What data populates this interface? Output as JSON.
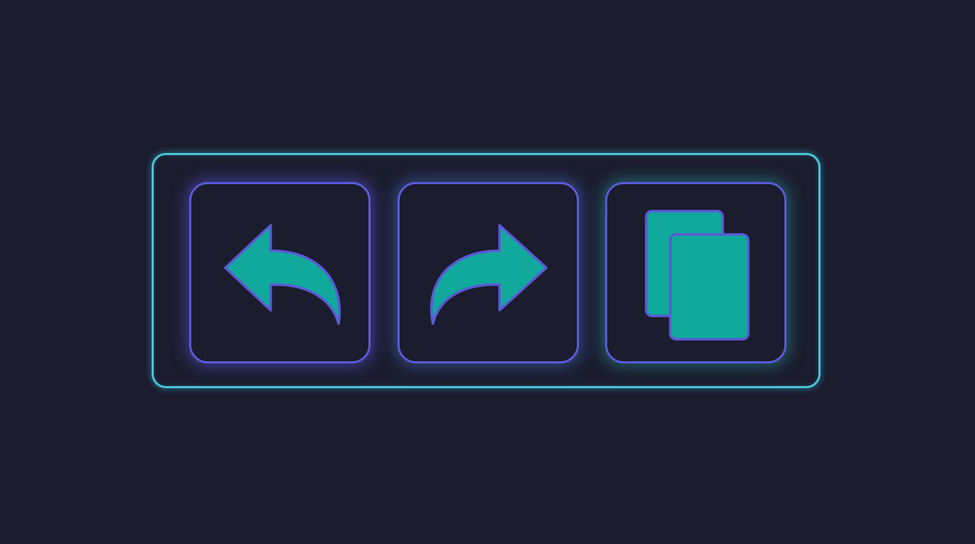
{
  "toolbar": {
    "buttons": [
      {
        "id": "undo",
        "icon": "undo-arrow-icon"
      },
      {
        "id": "redo",
        "icon": "redo-arrow-icon"
      },
      {
        "id": "copy",
        "icon": "copy-icon"
      }
    ]
  },
  "colors": {
    "background": "#1b1c2e",
    "toolbar_border": "#49c4d8",
    "button_border": "#5a5ad8",
    "icon_fill": "#11a99b",
    "icon_outline": "#5a5ad8"
  }
}
